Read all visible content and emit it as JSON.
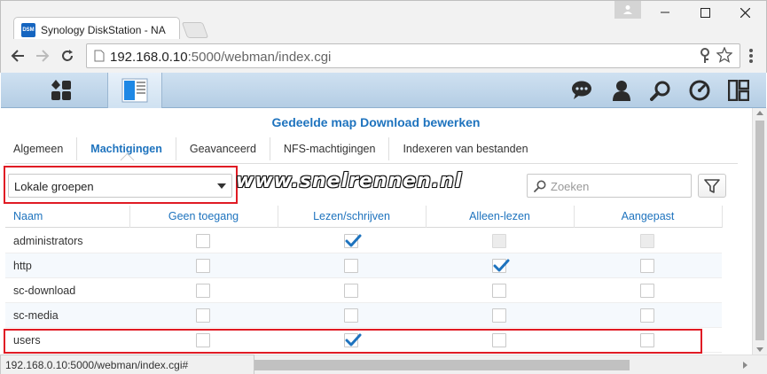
{
  "browser": {
    "tab_title": "Synology DiskStation - NA",
    "favicon_text": "DSM",
    "url_host": "192.168.0.10",
    "url_rest": ":5000/webman/index.cgi",
    "status_url": "192.168.0.10:5000/webman/index.cgi#"
  },
  "dsm": {
    "icons": [
      "app-grid-icon",
      "control-panel-icon",
      "notification-chat-icon",
      "user-icon",
      "search-icon",
      "resource-monitor-icon",
      "widgets-icon"
    ]
  },
  "window": {
    "title": "Gedeelde map Download bewerken",
    "tabs": [
      {
        "label": "Algemeen"
      },
      {
        "label": "Machtigingen",
        "active": true
      },
      {
        "label": "Geavanceerd"
      },
      {
        "label": "NFS-machtigingen"
      },
      {
        "label": "Indexeren van bestanden"
      }
    ]
  },
  "filter": {
    "selected": "Lokale groepen"
  },
  "watermark": "www.snelrennen.nl",
  "search": {
    "placeholder": "Zoeken",
    "value": ""
  },
  "table": {
    "columns": [
      "Naam",
      "Geen toegang",
      "Lezen/schrijven",
      "Alleen-lezen",
      "Aangepast"
    ],
    "rows": [
      {
        "name": "administrators",
        "checks": [
          false,
          true,
          false,
          false
        ],
        "disabled": [
          false,
          false,
          true,
          true
        ]
      },
      {
        "name": "http",
        "checks": [
          false,
          false,
          true,
          false
        ],
        "disabled": [
          false,
          false,
          false,
          false
        ]
      },
      {
        "name": "sc-download",
        "checks": [
          false,
          false,
          false,
          false
        ],
        "disabled": [
          false,
          false,
          false,
          false
        ]
      },
      {
        "name": "sc-media",
        "checks": [
          false,
          false,
          false,
          false
        ],
        "disabled": [
          false,
          false,
          false,
          false
        ]
      },
      {
        "name": "users",
        "checks": [
          false,
          true,
          false,
          false
        ],
        "disabled": [
          false,
          false,
          false,
          false
        ]
      }
    ]
  },
  "colors": {
    "accent": "#1e73be",
    "highlight_box": "#e01b24",
    "check": "#1e73be"
  }
}
